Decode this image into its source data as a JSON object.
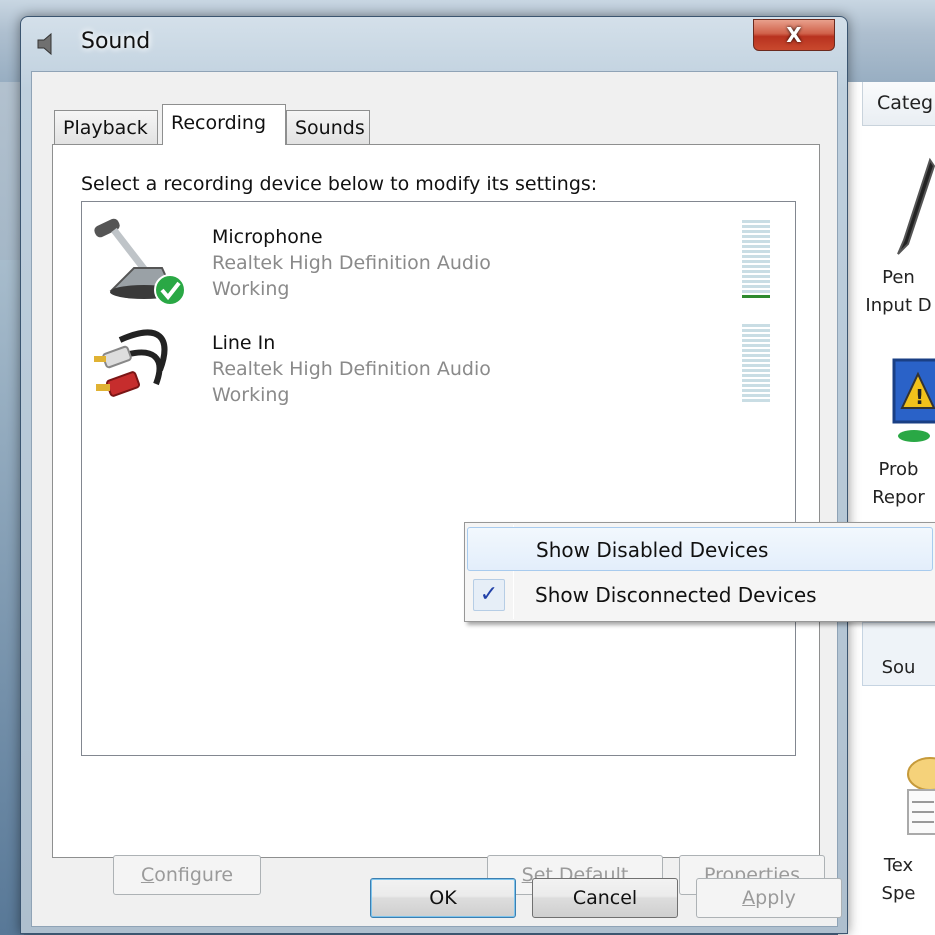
{
  "background": {
    "panel_header": "Categ",
    "items": [
      {
        "label1": "Pen",
        "label2": "Input D"
      },
      {
        "label1": "Prob",
        "label2": "Repor"
      },
      {
        "label1": "Sou",
        "label2": ""
      },
      {
        "label1": "Tex",
        "label2": "Spe"
      }
    ]
  },
  "dialog": {
    "title": "Sound",
    "close_label": "X",
    "tabs": [
      {
        "label": "Playback"
      },
      {
        "label": "Recording"
      },
      {
        "label": "Sounds"
      }
    ],
    "active_tab": "Recording",
    "instruction": "Select a recording device below to modify its settings:",
    "devices": [
      {
        "name": "Microphone",
        "driver": "Realtek High Definition Audio",
        "status": "Working",
        "is_default": true,
        "level_bars_lit": 1
      },
      {
        "name": "Line In",
        "driver": "Realtek High Definition Audio",
        "status": "Working",
        "is_default": false,
        "level_bars_lit": 0
      }
    ],
    "buttons": {
      "configure": {
        "mnemonic": "C",
        "rest": "onfigure"
      },
      "set_default": {
        "mnemonic": "S",
        "rest": "et Default"
      },
      "properties": {
        "mnemonic": "P",
        "rest": "roperties"
      },
      "ok": "OK",
      "cancel": "Cancel",
      "apply": {
        "mnemonic": "A",
        "rest": "pply"
      }
    }
  },
  "context_menu": {
    "items": [
      {
        "label": "Show Disabled Devices",
        "checked": false
      },
      {
        "label": "Show Disconnected Devices",
        "checked": true
      }
    ],
    "check_glyph": "✓"
  },
  "colors": {
    "title_close": "#c9492e",
    "level_on": "#2e8b2e",
    "level_off": "#c9dde4",
    "menu_highlight": "#e3eefb"
  }
}
